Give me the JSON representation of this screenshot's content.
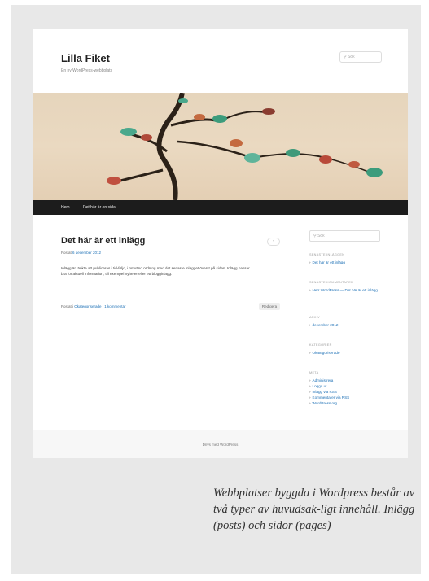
{
  "site": {
    "title": "Lilla Fiket",
    "description": " Én ny WordPress-webbplats",
    "search_top_placeholder": "Sök",
    "nav": [
      "Hem",
      "Det här är en sida"
    ]
  },
  "post": {
    "title": "Det här är ett inlägg",
    "meta_prefix": "Postat ",
    "meta_date": "6 december 2012",
    "comment_count": "1",
    "body": "Inlägg är tänkta att publiceras i tid-följd, i omvänd ordning med det senaste inlägget överst på sidan. Inlägg passar bra för aktuell information, till exempel nyheter eller ett blogginlägg.",
    "footer_prefix": "Postat i ",
    "footer_category": "Okategoriserade",
    "footer_sep": " | ",
    "footer_comment": "1 kommentar",
    "edit_label": "Redigera"
  },
  "sidebar": {
    "search_placeholder": "Sök",
    "widgets": [
      {
        "title": "SENASTE INLÄGGEN",
        "links": [
          "Det här är ett inlägg"
        ]
      },
      {
        "title": "SENASTE KOMMENTARER",
        "links": [
          "Herr WordPress — Det här är ett inlägg"
        ]
      },
      {
        "title": "ARKIV",
        "links": [
          "december 2012"
        ]
      },
      {
        "title": "KATEGORIER",
        "links": [
          "Okategoriserade"
        ]
      },
      {
        "title": "META",
        "links": [
          "Administrera",
          "Logga ut",
          "Inlägg via RSS",
          "Kommentarer via RSS",
          "WordPress.org"
        ]
      }
    ]
  },
  "footer": {
    "text": "Drivs med WordPress"
  },
  "caption": "Webbplatser byggda i Wordpress består av två typer av huvudsak-ligt innehåll. Inlägg (posts) och sidor (pages)"
}
